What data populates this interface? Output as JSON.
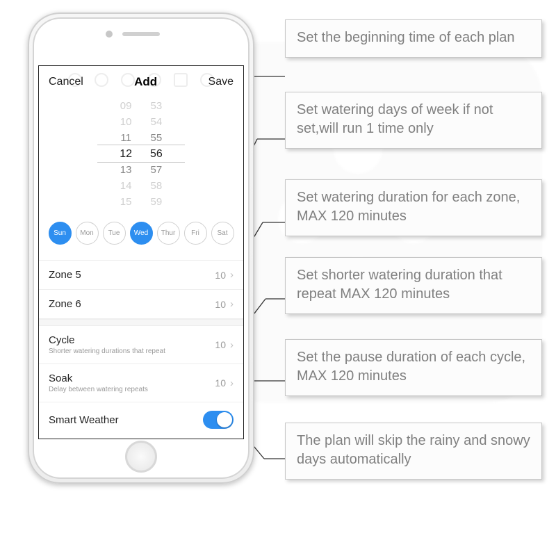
{
  "header": {
    "cancel": "Cancel",
    "title": "Add",
    "save": "Save"
  },
  "picker": {
    "hours": [
      "09",
      "10",
      "11",
      "12",
      "13",
      "14",
      "15"
    ],
    "minutes": [
      "53",
      "54",
      "55",
      "56",
      "57",
      "58",
      "59"
    ],
    "selected_index": 3
  },
  "days": {
    "labels": [
      "Sun",
      "Mon",
      "Tue",
      "Wed",
      "Thur",
      "Fri",
      "Sat"
    ],
    "selected": [
      true,
      false,
      false,
      true,
      false,
      false,
      false
    ]
  },
  "zones": [
    {
      "label": "Zone 5",
      "value": "10"
    },
    {
      "label": "Zone 6",
      "value": "10"
    }
  ],
  "cycle": {
    "label": "Cycle",
    "sub": "Shorter watering durations that repeat",
    "value": "10"
  },
  "soak": {
    "label": "Soak",
    "sub": "Delay between watering repeats",
    "value": "10"
  },
  "smart": {
    "label": "Smart Weather",
    "on": true
  },
  "callouts": [
    "Set the beginning time of each plan",
    "Set watering days of week if not set,will run 1 time only",
    "Set watering duration for each zone, MAX 120 minutes",
    "Set shorter watering duration that repeat MAX 120 minutes",
    "Set the pause duration of each cycle, MAX 120 minutes",
    "The plan will skip the rainy and snowy days automatically"
  ]
}
